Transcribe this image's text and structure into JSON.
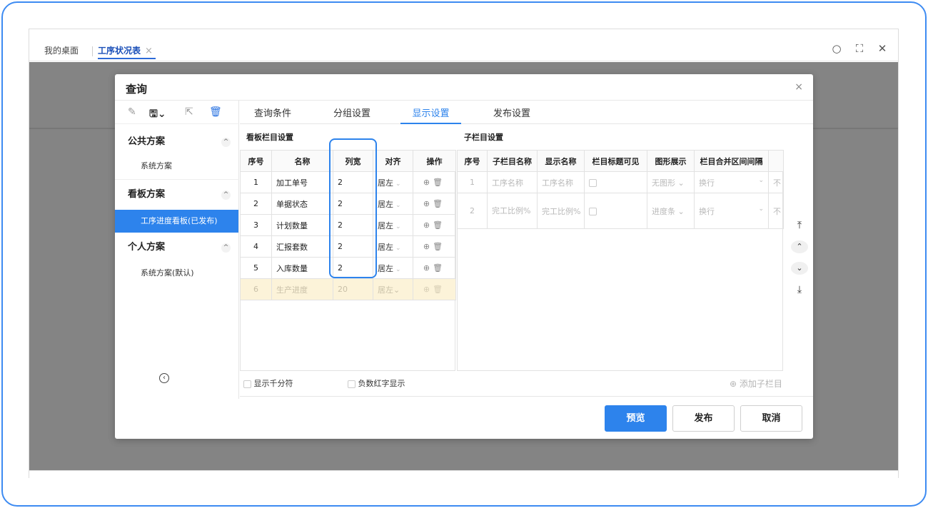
{
  "tabs": {
    "desktop": "我的桌面",
    "current": "工序状况表",
    "close": "×"
  },
  "window_icons": {
    "search": "○",
    "fullscreen": "⛶",
    "close": "✕"
  },
  "dialog": {
    "title": "查询",
    "close": "×"
  },
  "left": {
    "toolbar": {
      "edit": "✎",
      "save": "🖫⌄",
      "export": "⇱",
      "delete": "🗑"
    },
    "groups": [
      {
        "label": "公共方案",
        "chevron": "^",
        "items": [
          "系统方案"
        ]
      },
      {
        "label": "看板方案",
        "chevron": "^",
        "items": [
          "工序进度看板(已发布)"
        ]
      },
      {
        "label": "个人方案",
        "chevron": "^",
        "items": [
          "系统方案(默认)"
        ]
      }
    ],
    "back": "‹"
  },
  "main_tabs": [
    "查询条件",
    "分组设置",
    "显示设置",
    "发布设置"
  ],
  "active_tab": "显示设置",
  "board": {
    "title": "看板栏目设置",
    "headers": [
      "序号",
      "名称",
      "列宽",
      "对齐",
      "操作"
    ],
    "rows": [
      {
        "no": "1",
        "name": "加工单号",
        "width": "2",
        "align": "居左"
      },
      {
        "no": "2",
        "name": "单据状态",
        "width": "2",
        "align": "居左"
      },
      {
        "no": "3",
        "name": "计划数量",
        "width": "2",
        "align": "居左"
      },
      {
        "no": "4",
        "name": "汇报套数",
        "width": "2",
        "align": "居左"
      },
      {
        "no": "5",
        "name": "入库数量",
        "width": "2",
        "align": "居左"
      }
    ],
    "new_row": {
      "no": "6",
      "name": "生产进度",
      "width": "20",
      "align": "居左"
    },
    "thousand_sep": "显示千分符",
    "negative_red": "负数红字显示"
  },
  "sub": {
    "title": "子栏目设置",
    "headers": [
      "序号",
      "子栏目名称",
      "显示名称",
      "栏目标题可见",
      "图形展示",
      "栏目合并区间间隔"
    ],
    "rows": [
      {
        "no": "1",
        "name": "工序名称",
        "display": "工序名称",
        "graph": "无图形",
        "merge": "换行",
        "extra": "不"
      },
      {
        "no": "2",
        "name": "完工比例%",
        "display": "完工比例%",
        "graph": "进度条",
        "merge": "换行",
        "extra": "不"
      }
    ],
    "add": "⊕ 添加子栏目"
  },
  "nav": {
    "top": "⤒",
    "up": "⌃",
    "down": "⌄",
    "bottom": "⤓"
  },
  "buttons": {
    "preview": "预览",
    "publish": "发布",
    "cancel": "取消"
  }
}
